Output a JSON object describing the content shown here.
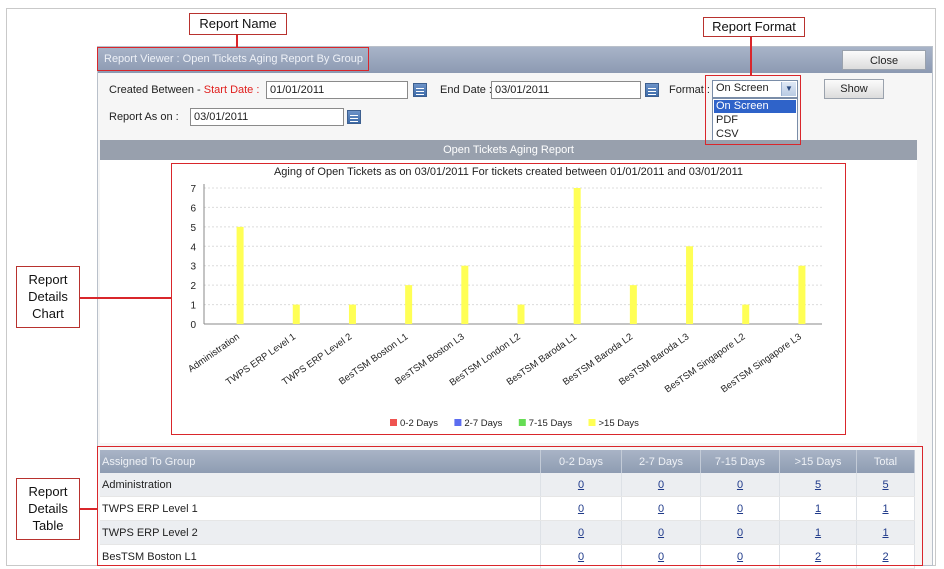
{
  "callouts": {
    "report_name": "Report Name",
    "report_format": "Report Format",
    "chart_lines": [
      "Report",
      "Details",
      "Chart"
    ],
    "table_lines": [
      "Report",
      "Details",
      "Table"
    ]
  },
  "viewer": {
    "title": "Report Viewer : Open Tickets Aging Report By Group",
    "close_label": "Close"
  },
  "filters": {
    "created_between_label": "Created Between - ",
    "start_date_label": "Start Date :",
    "start_date_value": "01/01/2011",
    "end_date_label": "End Date :",
    "end_date_value": "03/01/2011",
    "format_label": "Format :",
    "format_value": "On Screen",
    "format_options": [
      "On Screen",
      "PDF",
      "CSV"
    ],
    "report_as_on_label": "Report As on :",
    "report_as_on_value": "03/01/2011",
    "show_label": "Show"
  },
  "section_title": "Open Tickets Aging Report",
  "colors": {
    "days_0_2": "#ef5350",
    "days_2_7": "#5c6df0",
    "days_7_15": "#66dd55",
    "days_15_plus": "#ffff55",
    "highlight": "#d9262b"
  },
  "chart_data": {
    "type": "bar",
    "title": "Aging of Open Tickets as on 03/01/2011 For tickets created between 01/01/2011 and 03/01/2011",
    "categories": [
      "Administration",
      "TWPS ERP Level 1",
      "TWPS ERP Level 2",
      "BesTSM Boston L1",
      "BesTSM Boston L3",
      "BesTSM London L2",
      "BesTSM Baroda L1",
      "BesTSM Baroda L2",
      "BesTSM Baroda L3",
      "BesTSM Singapore L2",
      "BesTSM Singapore L3"
    ],
    "series": [
      {
        "name": "0-2 Days",
        "values": [
          0,
          0,
          0,
          0,
          0,
          0,
          0,
          0,
          0,
          0,
          0
        ]
      },
      {
        "name": "2-7 Days",
        "values": [
          0,
          0,
          0,
          0,
          0,
          0,
          0,
          0,
          0,
          0,
          0
        ]
      },
      {
        "name": "7-15 Days",
        "values": [
          0,
          0,
          0,
          0,
          0,
          0,
          0,
          0,
          0,
          0,
          0
        ]
      },
      {
        "name": ">15 Days",
        "values": [
          5,
          1,
          1,
          2,
          3,
          1,
          7,
          2,
          4,
          1,
          3
        ]
      }
    ],
    "y_ticks": [
      "0",
      "1",
      "2",
      "3",
      "4",
      "5",
      "6",
      "7"
    ],
    "ylim": [
      0,
      7
    ],
    "grid": true,
    "legend_position": "bottom"
  },
  "table": {
    "headers": [
      "Assigned To Group",
      "0-2 Days",
      "2-7 Days",
      "7-15 Days",
      ">15 Days",
      "Total"
    ],
    "rows": [
      [
        "Administration",
        "0",
        "0",
        "0",
        "5",
        "5"
      ],
      [
        "TWPS ERP Level 1",
        "0",
        "0",
        "0",
        "1",
        "1"
      ],
      [
        "TWPS ERP Level 2",
        "0",
        "0",
        "0",
        "1",
        "1"
      ],
      [
        "BesTSM Boston L1",
        "0",
        "0",
        "0",
        "2",
        "2"
      ]
    ]
  }
}
